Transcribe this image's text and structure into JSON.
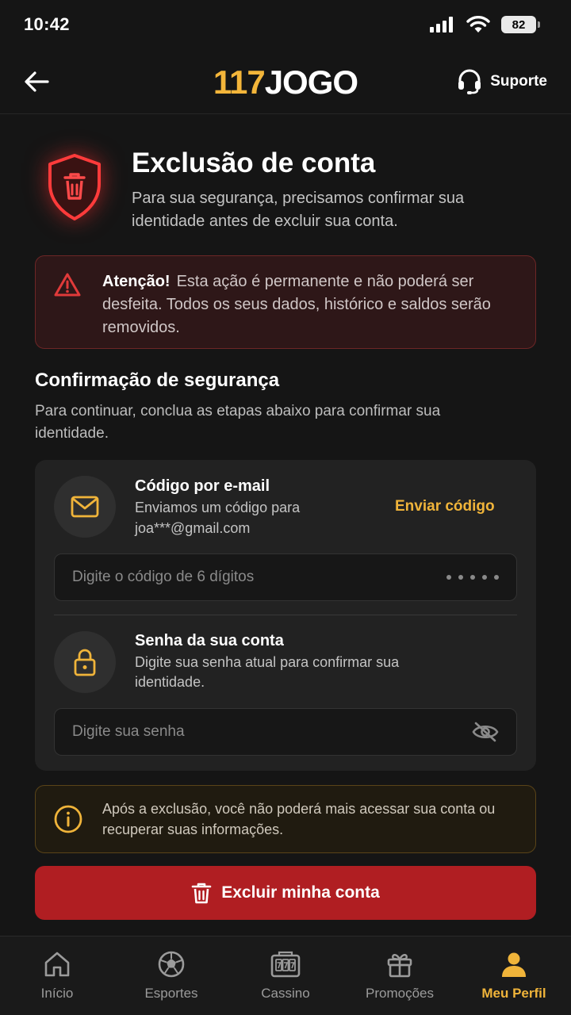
{
  "status_bar": {
    "time": "10:42",
    "battery": "82"
  },
  "header": {
    "logo_number": "117",
    "logo_text": "JOGO",
    "support_label": "Suporte"
  },
  "hero": {
    "title": "Exclusão de conta",
    "subtitle": "Para sua segurança, precisamos confirmar sua identidade antes de excluir sua conta."
  },
  "warning": {
    "label": "Atenção!",
    "text": "Esta ação é permanente e não poderá ser desfeita. Todos os seus dados, histórico e saldos serão removidos."
  },
  "security": {
    "title": "Confirmação de segurança",
    "subtitle": "Para continuar, conclua as etapas abaixo para confirmar sua identidade."
  },
  "email_step": {
    "title": "Código por e-mail",
    "line1": "Enviamos um código para",
    "line2": "joa***@gmail.com",
    "action": "Enviar código",
    "placeholder": "Digite o código de 6 dígitos"
  },
  "password_step": {
    "title": "Senha da sua conta",
    "description": "Digite sua senha atual para confirmar sua identidade.",
    "placeholder": "Digite sua senha"
  },
  "info": {
    "text": "Após a exclusão, você não poderá mais acessar sua conta ou recuperar suas informações."
  },
  "delete_button": {
    "label": "Excluir minha conta"
  },
  "tabs": [
    {
      "label": "Início",
      "icon": "home-icon"
    },
    {
      "label": "Esportes",
      "icon": "soccer-ball-icon"
    },
    {
      "label": "Cassino",
      "icon": "slot-machine-icon"
    },
    {
      "label": "Promoções",
      "icon": "gift-icon"
    },
    {
      "label": "Meu Perfil",
      "icon": "user-icon",
      "active": true
    }
  ],
  "colors": {
    "accent": "#f0b43a",
    "danger": "#b01e22",
    "background": "#151515"
  }
}
